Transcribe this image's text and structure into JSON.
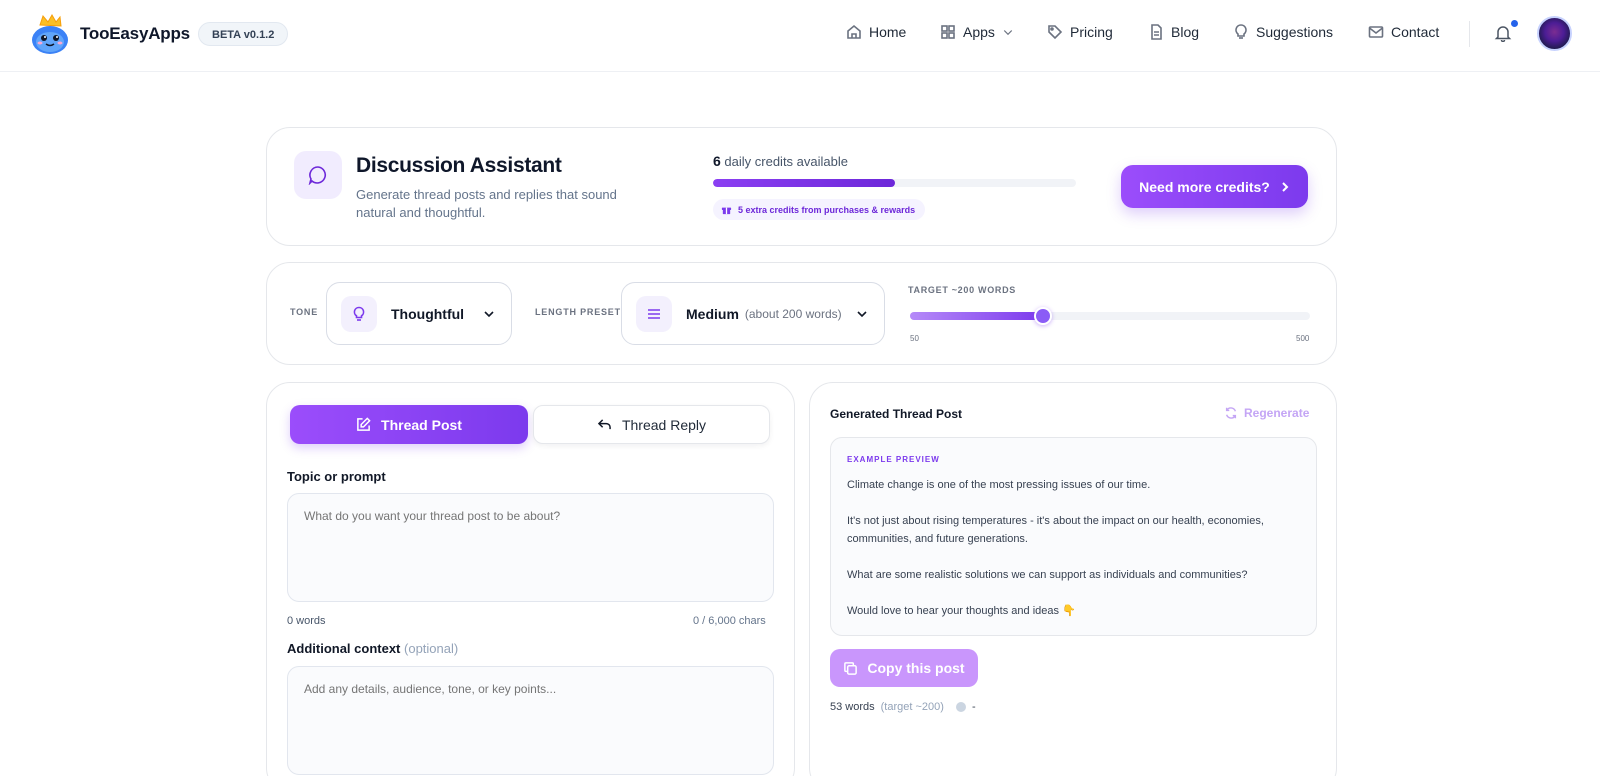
{
  "header": {
    "brand": "TooEasyApps",
    "beta_badge": "BETA v0.1.2",
    "nav": [
      {
        "label": "Home",
        "icon": "home-icon"
      },
      {
        "label": "Apps",
        "icon": "grid-icon"
      },
      {
        "label": "Pricing",
        "icon": "tag-icon"
      },
      {
        "label": "Blog",
        "icon": "document-icon"
      },
      {
        "label": "Suggestions",
        "icon": "lightbulb-icon"
      },
      {
        "label": "Contact",
        "icon": "mail-icon"
      }
    ],
    "notification_indicator_color": "#2563eb"
  },
  "tool": {
    "title": "Discussion Assistant",
    "subtitle": "Generate thread posts and replies that sound natural and thoughtful.",
    "credits_count": "6",
    "credits_label": "daily credits available",
    "credits_progress": 0.5,
    "extra_credits": "5 extra credits from purchases & rewards",
    "more_credits_button": "Need more credits?"
  },
  "controls": {
    "tone_label": "TONE",
    "tone_value": "Thoughtful",
    "length_label": "LENGTH PRESET",
    "length_value": "Medium",
    "length_hint": "(about 200 words)",
    "target_label": "TARGET ~200 WORDS",
    "slider_min": "50",
    "slider_max": "500",
    "slider_value": 200
  },
  "tabs": {
    "post": "Thread Post",
    "reply": "Thread Reply",
    "active": "post"
  },
  "form": {
    "topic_label": "Topic or prompt",
    "topic_placeholder": "What do you want your thread post to be about?",
    "word_count": "0 words",
    "char_count": "0 / 6,000 chars",
    "context_label": "Additional context",
    "context_optional": "(optional)",
    "context_placeholder": "Add any details, audience, tone, or key points..."
  },
  "output": {
    "title": "Generated Thread Post",
    "regenerate": "Regenerate",
    "preview_tag": "EXAMPLE PREVIEW",
    "lines": [
      "Climate change is one of the most pressing issues of our time.",
      "It's not just about rising temperatures - it's about the impact on our health, economies, communities, and future generations.",
      "What are some realistic solutions we can support as individuals and communities?",
      "Would love to hear your thoughts and ideas 👇"
    ],
    "copy_button": "Copy this post",
    "word_stat": "53 words",
    "word_target": "(target ~200)",
    "status_dash": "-"
  },
  "colors": {
    "accent": "#7c3aed",
    "accent_light": "#9b4dfb"
  }
}
